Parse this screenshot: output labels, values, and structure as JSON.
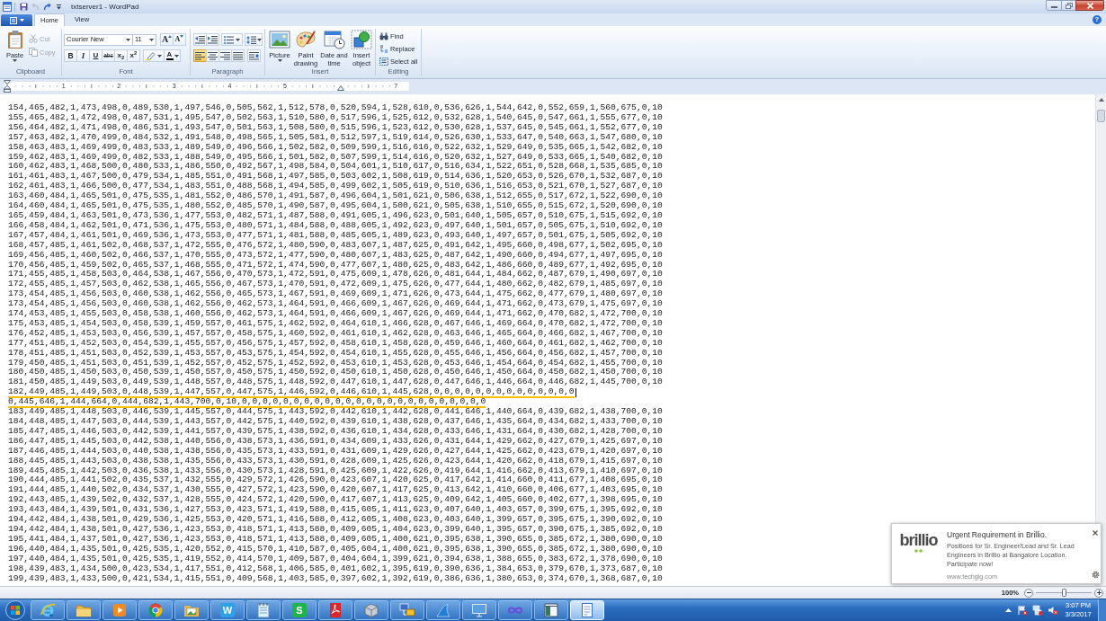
{
  "window": {
    "title": "txtserver1 - WordPad"
  },
  "quick_access": [
    {
      "kind": "save",
      "disabled": false
    },
    {
      "kind": "undo",
      "disabled": true
    },
    {
      "kind": "redo",
      "disabled": false
    },
    {
      "kind": "customize",
      "disabled": false
    }
  ],
  "ribbon": {
    "tabs": [
      {
        "label": "Home",
        "selected": true
      },
      {
        "label": "View",
        "selected": false
      }
    ],
    "help": "?",
    "clipboard": {
      "label": "Clipboard",
      "paste": "Paste",
      "items": [
        {
          "kind": "cut",
          "label": "Cut",
          "disabled": true
        },
        {
          "kind": "copy",
          "label": "Copy",
          "disabled": true
        }
      ]
    },
    "font": {
      "label": "Font",
      "family": "Courier New",
      "size": "11",
      "grow": "A",
      "shrink": "A",
      "styles": [
        {
          "kind": "bold",
          "text": "B"
        },
        {
          "kind": "italic",
          "text": "I"
        },
        {
          "kind": "underline",
          "text": "U"
        },
        {
          "kind": "strike",
          "text": "abc"
        },
        {
          "kind": "subscript",
          "text": "x$_{2}$"
        },
        {
          "kind": "superscript",
          "text": "x$^{2}$"
        }
      ],
      "font_color": "A"
    },
    "paragraph": {
      "label": "Paragraph",
      "alignment": [
        {
          "kind": "left",
          "selected": true
        },
        {
          "kind": "center",
          "selected": false
        },
        {
          "kind": "right",
          "selected": false
        },
        {
          "kind": "justify",
          "selected": false
        }
      ]
    },
    "insert": {
      "label": "Insert",
      "items": [
        {
          "kind": "picture",
          "label": "Picture",
          "dropdown": true
        },
        {
          "kind": "paint",
          "label": "Paint drawing",
          "dropdown": false
        },
        {
          "kind": "datetime",
          "label": "Date and time",
          "dropdown": false
        },
        {
          "kind": "object",
          "label": "Insert object",
          "dropdown": false
        }
      ]
    },
    "editing": {
      "label": "Editing",
      "items": [
        {
          "kind": "find",
          "label": "Find"
        },
        {
          "kind": "replace",
          "label": "Replace"
        },
        {
          "kind": "select_all",
          "label": "Select all"
        }
      ]
    }
  },
  "ruler": {
    "marks": [
      {
        "kind": "number",
        "label": "1"
      },
      {
        "kind": "number",
        "label": "2"
      },
      {
        "kind": "number",
        "label": "3"
      },
      {
        "kind": "number",
        "label": "4"
      },
      {
        "kind": "number",
        "label": "5"
      },
      {
        "kind": "indent"
      },
      {
        "kind": "number",
        "label": "7"
      }
    ]
  },
  "document": {
    "lines": [
      {
        "text": "154,465,482,1,473,498,0,489,530,1,497,546,0,505,562,1,512,578,0,520,594,1,528,610,0,536,626,1,544,642,0,552,659,1,560,675,0,10",
        "marked": false,
        "caret": false
      },
      {
        "text": "155,465,482,1,472,498,0,487,531,1,495,547,0,502,563,1,510,580,0,517,596,1,525,612,0,532,628,1,540,645,0,547,661,1,555,677,0,10",
        "marked": false,
        "caret": false
      },
      {
        "text": "156,464,482,1,471,498,0,486,531,1,493,547,0,501,563,1,508,580,0,515,596,1,523,612,0,530,628,1,537,645,0,545,661,1,552,677,0,10",
        "marked": false,
        "caret": false
      },
      {
        "text": "157,463,482,1,470,499,0,484,532,1,491,548,0,498,565,1,505,581,0,512,597,1,519,614,0,526,630,1,533,647,0,540,663,1,547,680,0,10",
        "marked": false,
        "caret": false
      },
      {
        "text": "158,463,483,1,469,499,0,483,533,1,489,549,0,496,566,1,502,582,0,509,599,1,516,616,0,522,632,1,529,649,0,535,665,1,542,682,0,10",
        "marked": false,
        "caret": false
      },
      {
        "text": "159,462,483,1,469,499,0,482,533,1,488,549,0,495,566,1,501,582,0,507,599,1,514,616,0,520,632,1,527,649,0,533,665,1,540,682,0,10",
        "marked": false,
        "caret": false
      },
      {
        "text": "160,462,483,1,468,500,0,480,533,1,486,550,0,492,567,1,498,584,0,504,601,1,510,617,0,516,634,1,522,651,0,528,668,1,535,685,0,10",
        "marked": false,
        "caret": false
      },
      {
        "text": "161,461,483,1,467,500,0,479,534,1,485,551,0,491,568,1,497,585,0,503,602,1,508,619,0,514,636,1,520,653,0,526,670,1,532,687,0,10",
        "marked": false,
        "caret": false
      },
      {
        "text": "162,461,483,1,466,500,0,477,534,1,483,551,0,488,568,1,494,585,0,499,602,1,505,619,0,510,636,1,516,653,0,521,670,1,527,687,0,10",
        "marked": false,
        "caret": false
      },
      {
        "text": "163,460,484,1,465,501,0,475,535,1,481,552,0,486,570,1,491,587,0,496,604,1,501,621,0,506,638,1,512,655,0,517,672,1,522,690,0,10",
        "marked": false,
        "caret": false
      },
      {
        "text": "164,460,484,1,465,501,0,475,535,1,480,552,0,485,570,1,490,587,0,495,604,1,500,621,0,505,638,1,510,655,0,515,672,1,520,690,0,10",
        "marked": false,
        "caret": false
      },
      {
        "text": "165,459,484,1,463,501,0,473,536,1,477,553,0,482,571,1,487,588,0,491,605,1,496,623,0,501,640,1,505,657,0,510,675,1,515,692,0,10",
        "marked": false,
        "caret": false
      },
      {
        "text": "166,458,484,1,462,501,0,471,536,1,475,553,0,480,571,1,484,588,0,488,605,1,492,623,0,497,640,1,501,657,0,505,675,1,510,692,0,10",
        "marked": false,
        "caret": false
      },
      {
        "text": "167,457,484,1,461,501,0,469,536,1,473,553,0,477,571,1,481,588,0,485,605,1,489,623,0,493,640,1,497,657,0,501,675,1,505,692,0,10",
        "marked": false,
        "caret": false
      },
      {
        "text": "168,457,485,1,461,502,0,468,537,1,472,555,0,476,572,1,480,590,0,483,607,1,487,625,0,491,642,1,495,660,0,498,677,1,502,695,0,10",
        "marked": false,
        "caret": false
      },
      {
        "text": "169,456,485,1,460,502,0,466,537,1,470,555,0,473,572,1,477,590,0,480,607,1,483,625,0,487,642,1,490,660,0,494,677,1,497,695,0,10",
        "marked": false,
        "caret": false
      },
      {
        "text": "170,456,485,1,459,502,0,465,537,1,468,555,0,471,572,1,474,590,0,477,607,1,480,625,0,483,642,1,486,660,0,489,677,1,492,695,0,10",
        "marked": false,
        "caret": false
      },
      {
        "text": "171,455,485,1,458,503,0,464,538,1,467,556,0,470,573,1,472,591,0,475,609,1,478,626,0,481,644,1,484,662,0,487,679,1,490,697,0,10",
        "marked": false,
        "caret": false
      },
      {
        "text": "172,455,485,1,457,503,0,462,538,1,465,556,0,467,573,1,470,591,0,472,609,1,475,626,0,477,644,1,480,662,0,482,679,1,485,697,0,10",
        "marked": false,
        "caret": false
      },
      {
        "text": "173,454,485,1,456,503,0,460,538,1,462,556,0,465,573,1,467,591,0,469,609,1,471,626,0,473,644,1,475,662,0,477,679,1,480,697,0,10",
        "marked": false,
        "caret": false
      },
      {
        "text": "173,454,485,1,456,503,0,460,538,1,462,556,0,462,573,1,464,591,0,466,609,1,467,626,0,469,644,1,471,662,0,473,679,1,475,697,0,10",
        "marked": false,
        "caret": false
      },
      {
        "text": "174,453,485,1,455,503,0,458,538,1,460,556,0,462,573,1,464,591,0,466,609,1,467,626,0,469,644,1,471,662,0,470,682,1,472,700,0,10",
        "marked": false,
        "caret": false
      },
      {
        "text": "175,453,485,1,454,503,0,458,539,1,459,557,0,461,575,1,462,592,0,464,610,1,466,628,0,467,646,1,469,664,0,470,682,1,472,700,0,10",
        "marked": false,
        "caret": false
      },
      {
        "text": "176,452,485,1,453,503,0,456,539,1,457,557,0,458,575,1,460,592,0,461,610,1,462,628,0,463,646,1,465,664,0,466,682,1,467,700,0,10",
        "marked": false,
        "caret": false
      },
      {
        "text": "177,451,485,1,452,503,0,454,539,1,455,557,0,456,575,1,457,592,0,458,610,1,458,628,0,459,646,1,460,664,0,461,682,1,462,700,0,10",
        "marked": false,
        "caret": false
      },
      {
        "text": "178,451,485,1,451,503,0,452,539,1,453,557,0,453,575,1,454,592,0,454,610,1,455,628,0,455,646,1,456,664,0,456,682,1,457,700,0,10",
        "marked": false,
        "caret": false
      },
      {
        "text": "179,450,485,1,451,503,0,451,539,1,452,557,0,452,575,1,452,592,0,453,610,1,453,628,0,453,646,1,454,664,0,454,682,1,455,700,0,10",
        "marked": false,
        "caret": false
      },
      {
        "text": "180,450,485,1,450,503,0,450,539,1,450,557,0,450,575,1,450,592,0,450,610,1,450,628,0,450,646,1,450,664,0,450,682,1,450,700,0,10",
        "marked": false,
        "caret": false
      },
      {
        "text": "181,450,485,1,449,503,0,449,539,1,448,557,0,448,575,1,448,592,0,447,610,1,447,628,0,447,646,1,446,664,0,446,682,1,445,700,0,10",
        "marked": false,
        "caret": false
      },
      {
        "text": "182,449,485,1,449,503,0,448,539,1,447,557,0,447,575,1,446,592,0,446,610,1,445,628,0,0,0,0,0,0,0,0,0,0,0,0,0,0",
        "marked": true,
        "caret": true
      },
      {
        "text": "0,445,646,1,444,664,0,444,682,1,443,700,0,10,0,0,0,0,0,0,0,0,0,0,0,0,0,0,0,0,0,0,0,0,0,0,0,0",
        "marked": true,
        "caret": false
      },
      {
        "text": "183,449,485,1,448,503,0,446,539,1,445,557,0,444,575,1,443,592,0,442,610,1,442,628,0,441,646,1,440,664,0,439,682,1,438,700,0,10",
        "marked": false,
        "caret": false
      },
      {
        "text": "184,448,485,1,447,503,0,444,539,1,443,557,0,442,575,1,440,592,0,439,610,1,438,628,0,437,646,1,435,664,0,434,682,1,433,700,0,10",
        "marked": false,
        "caret": false
      },
      {
        "text": "185,447,485,1,446,503,0,442,539,1,441,557,0,439,575,1,438,592,0,436,610,1,434,628,0,433,646,1,431,664,0,430,682,1,428,700,0,10",
        "marked": false,
        "caret": false
      },
      {
        "text": "186,447,485,1,445,503,0,442,538,1,440,556,0,438,573,1,436,591,0,434,609,1,433,626,0,431,644,1,429,662,0,427,679,1,425,697,0,10",
        "marked": false,
        "caret": false
      },
      {
        "text": "187,446,485,1,444,503,0,440,538,1,438,556,0,435,573,1,433,591,0,431,609,1,429,626,0,427,644,1,425,662,0,423,679,1,420,697,0,10",
        "marked": false,
        "caret": false
      },
      {
        "text": "188,445,485,1,443,503,0,438,538,1,435,556,0,433,573,1,430,591,0,428,609,1,425,626,0,423,644,1,420,662,0,418,679,1,415,697,0,10",
        "marked": false,
        "caret": false
      },
      {
        "text": "189,445,485,1,442,503,0,436,538,1,433,556,0,430,573,1,428,591,0,425,609,1,422,626,0,419,644,1,416,662,0,413,679,1,410,697,0,10",
        "marked": false,
        "caret": false
      },
      {
        "text": "190,444,485,1,441,502,0,435,537,1,432,555,0,429,572,1,426,590,0,423,607,1,420,625,0,417,642,1,414,660,0,411,677,1,408,695,0,10",
        "marked": false,
        "caret": false
      },
      {
        "text": "191,444,485,1,440,502,0,434,537,1,430,555,0,427,572,1,423,590,0,420,607,1,417,625,0,413,642,1,410,660,0,406,677,1,403,695,0,10",
        "marked": false,
        "caret": false
      },
      {
        "text": "192,443,485,1,439,502,0,432,537,1,428,555,0,424,572,1,420,590,0,417,607,1,413,625,0,409,642,1,405,660,0,402,677,1,398,695,0,10",
        "marked": false,
        "caret": false
      },
      {
        "text": "193,443,484,1,439,501,0,431,536,1,427,553,0,423,571,1,419,588,0,415,605,1,411,623,0,407,640,1,403,657,0,399,675,1,395,692,0,10",
        "marked": false,
        "caret": false
      },
      {
        "text": "194,442,484,1,438,501,0,429,536,1,425,553,0,420,571,1,416,588,0,412,605,1,408,623,0,403,640,1,399,657,0,395,675,1,390,692,0,10",
        "marked": false,
        "caret": false
      },
      {
        "text": "194,442,484,1,438,501,0,427,536,1,423,553,0,418,571,1,413,588,0,409,605,1,404,623,0,399,640,1,395,657,0,390,675,1,385,692,0,10",
        "marked": false,
        "caret": false
      },
      {
        "text": "195,441,484,1,437,501,0,427,536,1,423,553,0,418,571,1,413,588,0,409,605,1,400,621,0,395,638,1,390,655,0,385,672,1,380,690,0,10",
        "marked": false,
        "caret": false
      },
      {
        "text": "196,440,484,1,435,501,0,425,535,1,420,552,0,415,570,1,410,587,0,405,604,1,400,621,0,395,638,1,390,655,0,385,672,1,380,690,0,10",
        "marked": false,
        "caret": false
      },
      {
        "text": "197,440,484,1,435,501,0,425,535,1,419,552,0,414,570,1,409,587,0,404,604,1,399,621,0,394,638,1,388,655,0,383,672,1,378,690,0,10",
        "marked": false,
        "caret": false
      },
      {
        "text": "198,439,483,1,434,500,0,423,534,1,417,551,0,412,568,1,406,585,0,401,602,1,395,619,0,390,636,1,384,653,0,379,670,1,373,687,0,10",
        "marked": false,
        "caret": false
      },
      {
        "text": "199,439,483,1,433,500,0,421,534,1,415,551,0,409,568,1,403,585,0,397,602,1,392,619,0,386,636,1,380,653,0,374,670,1,368,687,0,10",
        "marked": false,
        "caret": false
      }
    ]
  },
  "status_bar": {
    "zoom": "100%",
    "level": 0.5
  },
  "notification": {
    "logo": "brillio",
    "title": "Urgent Requirement in Brillio.",
    "message": "Positions for Sr. Engineer/Lead and Sr. Lead Engineers in Brillio at Bangalore Location. Participate now!",
    "source": "www.techgig.com"
  },
  "taskbar": {
    "apps": [
      {
        "kind": "ie",
        "selected": false
      },
      {
        "kind": "explorer",
        "selected": false
      },
      {
        "kind": "media",
        "selected": false
      },
      {
        "kind": "chrome",
        "selected": false
      },
      {
        "kind": "gallery",
        "selected": false
      },
      {
        "kind": "writer",
        "glyph": "W",
        "selected": false
      },
      {
        "kind": "notepad",
        "selected": false
      },
      {
        "kind": "sheets",
        "glyph": "S",
        "selected": false
      },
      {
        "kind": "pdf",
        "selected": false
      },
      {
        "kind": "cube",
        "selected": false
      },
      {
        "kind": "network",
        "selected": false
      },
      {
        "kind": "fin",
        "selected": false
      },
      {
        "kind": "monitor",
        "selected": false
      },
      {
        "kind": "infinity",
        "selected": false
      },
      {
        "kind": "panel",
        "selected": false
      },
      {
        "kind": "wordpad",
        "selected": true
      }
    ],
    "clock": {
      "time": "3:07 PM",
      "date": "3/3/2017"
    }
  }
}
